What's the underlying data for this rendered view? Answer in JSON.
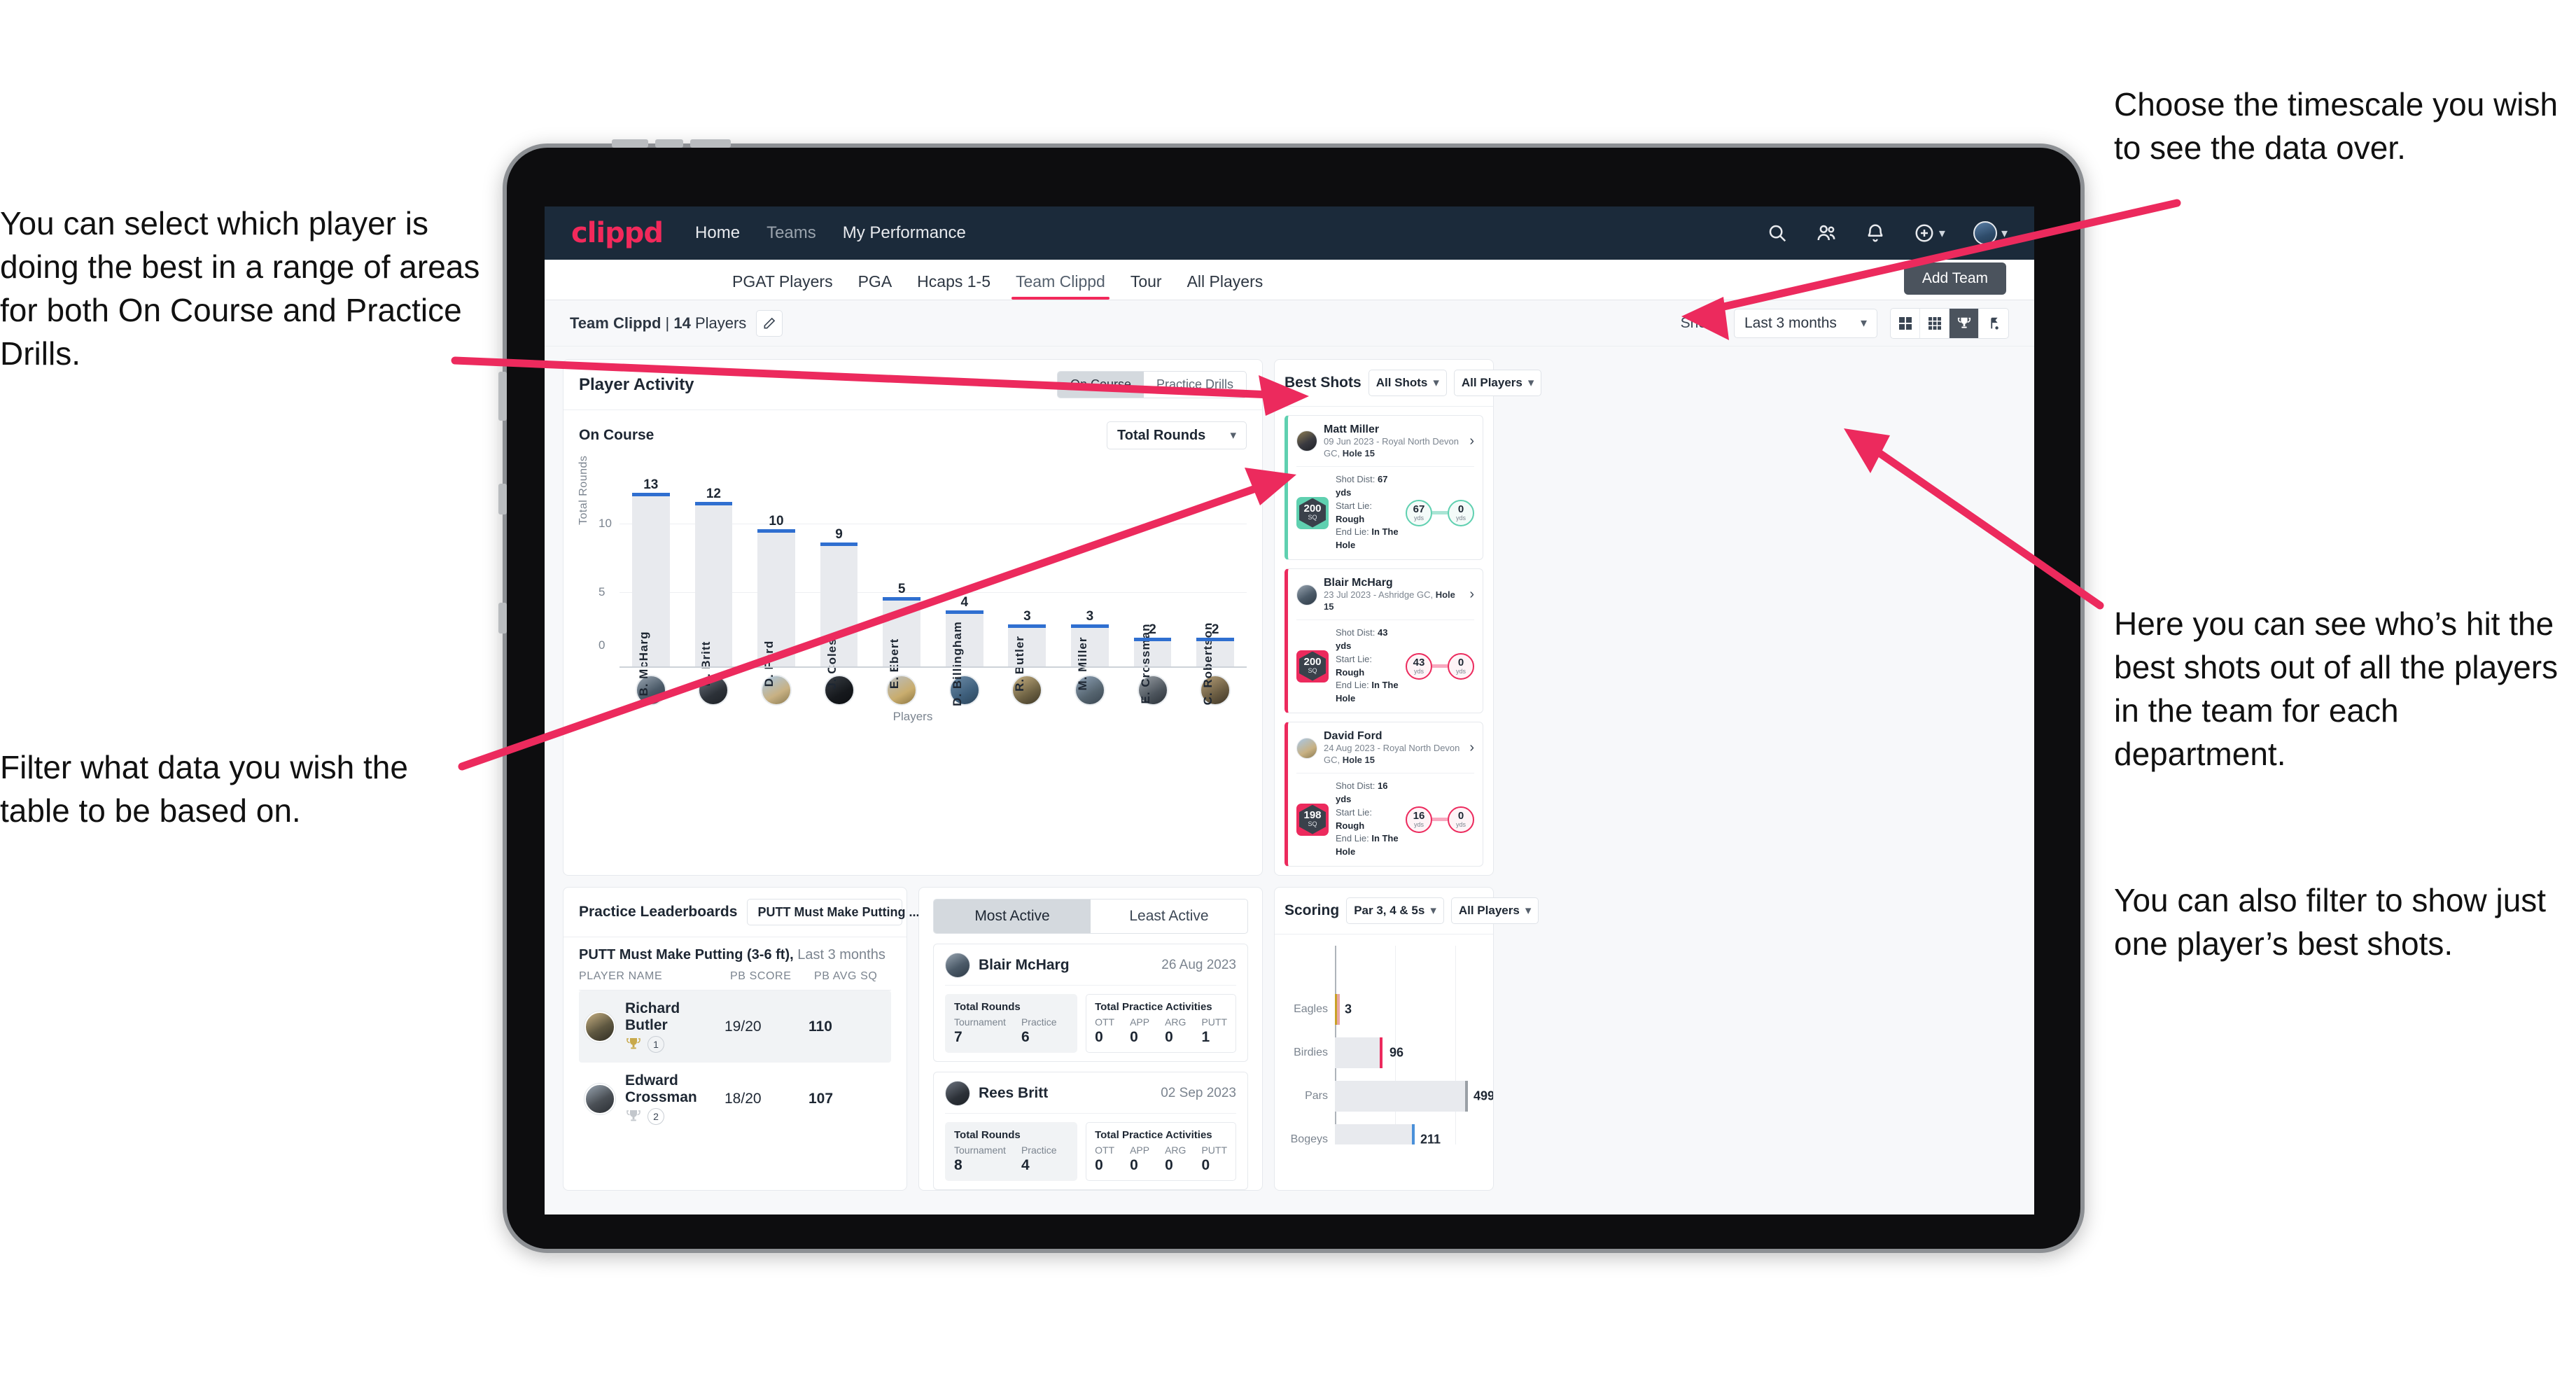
{
  "annotations": {
    "left_top": "You can select which player is doing the best in a range of areas for both On Course and Practice Drills.",
    "left_bottom": "Filter what data you wish the table to be based on.",
    "right_top": "Choose the timescale you wish to see the data over.",
    "right_middle": "Here you can see who’s hit the best shots out of all the players in the team for each department.",
    "right_bottom": "You can also filter to show just one player’s best shots."
  },
  "topnav": {
    "logo": "clippd",
    "links": [
      {
        "label": "Home",
        "active": true
      },
      {
        "label": "Teams",
        "active": false
      },
      {
        "label": "My Performance",
        "active": true
      }
    ],
    "icons": [
      "search-icon",
      "people-icon",
      "bell-icon",
      "plus-circle-icon",
      "avatar"
    ]
  },
  "subtabs": [
    {
      "label": "PGAT Players",
      "active": false
    },
    {
      "label": "PGA",
      "active": false
    },
    {
      "label": "Hcaps 1-5",
      "active": false
    },
    {
      "label": "Team Clippd",
      "active": true
    },
    {
      "label": "Tour",
      "active": false
    },
    {
      "label": "All Players",
      "active": false
    }
  ],
  "add_team_label": "Add Team",
  "toolbar": {
    "team_name": "Team Clippd",
    "separator": " | ",
    "player_count": "14",
    "players_word": " Players",
    "show_label": "Show:",
    "period_value": "Last 3 months",
    "view_icons": [
      "grid-large-icon",
      "grid-small-icon",
      "trophy-icon",
      "flag-icon"
    ],
    "active_view": "trophy-icon"
  },
  "player_activity": {
    "title": "Player Activity",
    "segments": [
      {
        "label": "On Course",
        "active": true
      },
      {
        "label": "Practice Drills",
        "active": false
      }
    ],
    "sub_label": "On Course",
    "metric_select": "Total Rounds"
  },
  "chart_data": [
    {
      "type": "bar",
      "title": "Player Activity — On Course",
      "categories": [
        "B. McHarg",
        "R. Britt",
        "D. Ford",
        "J. Coles",
        "E. Ebert",
        "D. Billingham",
        "R. Butler",
        "M. Miller",
        "E. Crossman",
        "C. Robertson"
      ],
      "values": [
        13,
        12,
        10,
        9,
        5,
        4,
        3,
        3,
        2,
        2
      ],
      "xlabel": "Players",
      "ylabel": "Total Rounds",
      "ylim": [
        0,
        14
      ],
      "yticks": [
        0,
        5,
        10
      ],
      "grid": true,
      "legend": "none",
      "bar_color": "#e8eaee",
      "cap_color": "#2f6fd0"
    },
    {
      "type": "bar",
      "orientation": "horizontal",
      "title": "Scoring",
      "categories": [
        "Eagles",
        "Birdies",
        "Pars",
        "Bogeys"
      ],
      "values": [
        3,
        96,
        499,
        211
      ],
      "xlabel": "",
      "ylabel": "",
      "xlim": [
        0,
        620
      ],
      "grid": true,
      "legend": "none",
      "cap_colors": [
        "#c9a227",
        "#ec2a5d",
        "#9aa0a6",
        "#4a90d9"
      ]
    }
  ],
  "best_shots": {
    "title": "Best Shots",
    "filter_shots": "All Shots",
    "filter_players": "All Players",
    "items": [
      {
        "name": "Matt Miller",
        "meta_prefix": "09 Jun 2023 - Royal North Devon GC, ",
        "meta_hole": "Hole 15",
        "sq": "200",
        "sq_unit": "SQ",
        "shot_dist_label": "Shot Dist: ",
        "shot_dist": "67 yds",
        "start_lie_label": "Start Lie: ",
        "start_lie": "Rough",
        "end_lie_label": "End Lie: ",
        "end_lie": "In The Hole",
        "from_value": "67",
        "from_unit": "yds",
        "to_value": "0",
        "to_unit": "yds",
        "accent": "teal"
      },
      {
        "name": "Blair McHarg",
        "meta_prefix": "23 Jul 2023 - Ashridge GC, ",
        "meta_hole": "Hole 15",
        "sq": "200",
        "sq_unit": "SQ",
        "shot_dist_label": "Shot Dist: ",
        "shot_dist": "43 yds",
        "start_lie_label": "Start Lie: ",
        "start_lie": "Rough",
        "end_lie_label": "End Lie: ",
        "end_lie": "In The Hole",
        "from_value": "43",
        "from_unit": "yds",
        "to_value": "0",
        "to_unit": "yds",
        "accent": "pink"
      },
      {
        "name": "David Ford",
        "meta_prefix": "24 Aug 2023 - Royal North Devon GC, ",
        "meta_hole": "Hole 15",
        "sq": "198",
        "sq_unit": "SQ",
        "shot_dist_label": "Shot Dist: ",
        "shot_dist": "16 yds",
        "start_lie_label": "Start Lie: ",
        "start_lie": "Rough",
        "end_lie_label": "End Lie: ",
        "end_lie": "In The Hole",
        "from_value": "16",
        "from_unit": "yds",
        "to_value": "0",
        "to_unit": "yds",
        "accent": "pink"
      }
    ]
  },
  "practice_leaderboards": {
    "title": "Practice Leaderboards",
    "drill_select": "PUTT Must Make Putting ...",
    "subtitle_bold": "PUTT Must Make Putting (3-6 ft),",
    "subtitle_rest": " Last 3 months",
    "columns": [
      "PLAYER NAME",
      "PB SCORE",
      "PB AVG SQ"
    ],
    "rows": [
      {
        "name": "Richard Butler",
        "rank": "1",
        "trophy": "gold",
        "pb_score": "19/20",
        "pb_avg_sq": "110",
        "highlight": true
      },
      {
        "name": "Edward Crossman",
        "rank": "2",
        "trophy": "silver",
        "pb_score": "18/20",
        "pb_avg_sq": "107",
        "highlight": false
      }
    ]
  },
  "activity_panel": {
    "tabs": [
      {
        "label": "Most Active",
        "active": true
      },
      {
        "label": "Least Active",
        "active": false
      }
    ],
    "cards": [
      {
        "name": "Blair McHarg",
        "date": "26 Aug 2023",
        "rounds_title": "Total Rounds",
        "rounds": [
          {
            "key": "Tournament",
            "value": "7"
          },
          {
            "key": "Practice",
            "value": "6"
          }
        ],
        "practice_title": "Total Practice Activities",
        "practice": [
          {
            "key": "OTT",
            "value": "0"
          },
          {
            "key": "APP",
            "value": "0"
          },
          {
            "key": "ARG",
            "value": "0"
          },
          {
            "key": "PUTT",
            "value": "1"
          }
        ]
      },
      {
        "name": "Rees Britt",
        "date": "02 Sep 2023",
        "rounds_title": "Total Rounds",
        "rounds": [
          {
            "key": "Tournament",
            "value": "8"
          },
          {
            "key": "Practice",
            "value": "4"
          }
        ],
        "practice_title": "Total Practice Activities",
        "practice": [
          {
            "key": "OTT",
            "value": "0"
          },
          {
            "key": "APP",
            "value": "0"
          },
          {
            "key": "ARG",
            "value": "0"
          },
          {
            "key": "PUTT",
            "value": "0"
          }
        ]
      }
    ]
  },
  "scoring": {
    "title": "Scoring",
    "filter_par": "Par 3, 4 & 5s",
    "filter_players": "All Players"
  },
  "colors": {
    "brand_pink": "#f2295b",
    "nav_dark": "#1b2a3a",
    "teal": "#5fd0b0",
    "bar_cap_blue": "#2f6fd0",
    "bar_fill": "#e8eaee"
  }
}
